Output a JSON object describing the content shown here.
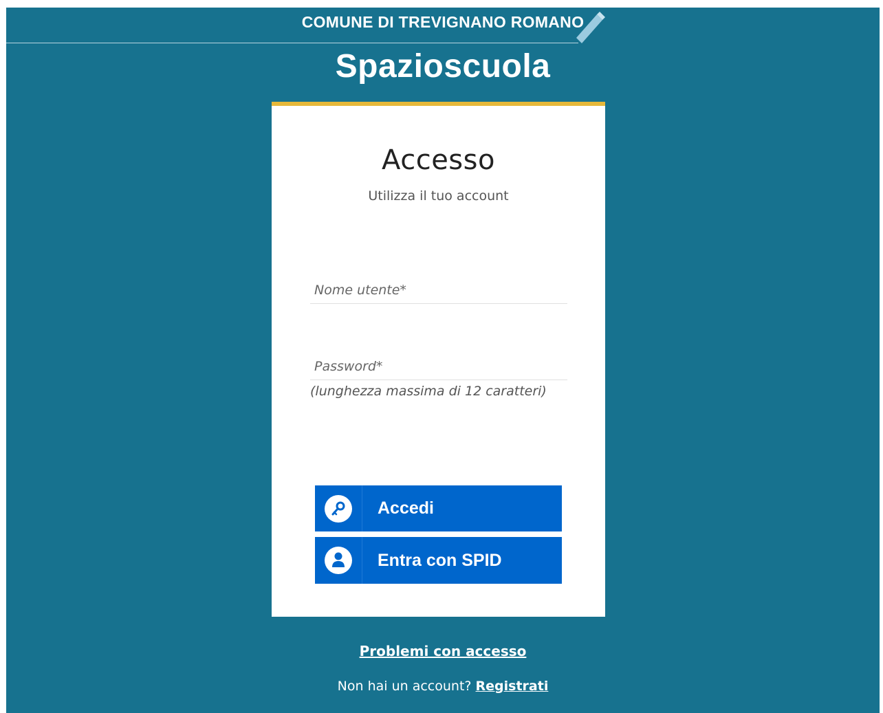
{
  "header": {
    "municipality": "COMUNE DI TREVIGNANO ROMANO",
    "app_name": "Spazioscuola"
  },
  "login": {
    "title": "Accesso",
    "subtitle": "Utilizza il tuo account",
    "username_placeholder": "Nome utente*",
    "password_placeholder": "Password*",
    "password_hint": "(lunghezza massima di 12 caratteri)",
    "login_button": "Accedi",
    "spid_button": "Entra con SPID"
  },
  "footer": {
    "problems_link": "Problemi con accesso",
    "no_account_text": "Non hai un account?",
    "register_link": "Registrati"
  },
  "colors": {
    "background": "#17728f",
    "accent_bar": "#e6b83a",
    "button": "#0066cc"
  }
}
